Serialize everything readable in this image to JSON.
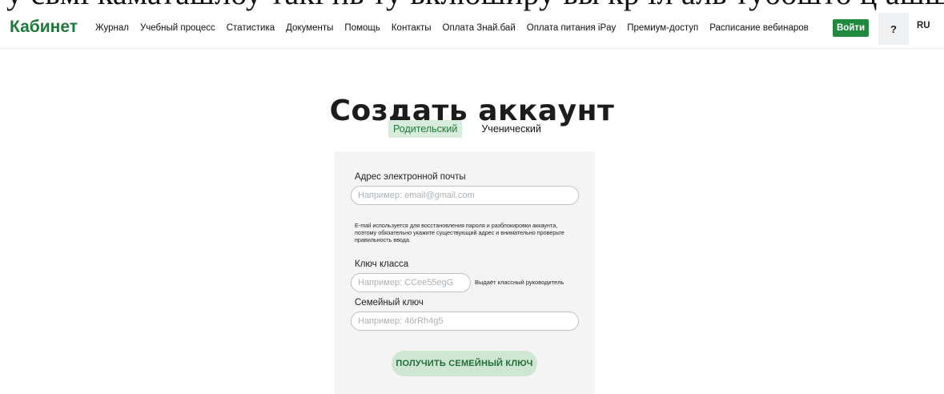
{
  "header": {
    "brand": "Кабинет",
    "nav_items": [
      "Журнал",
      "Учебный процесс",
      "Статистика",
      "Документы",
      "Помощь",
      "Контакты",
      "Оплата Знай.бай",
      "Оплата питания iPay",
      "Премиум-доступ",
      "Расписание вебинаров"
    ],
    "login_label": "Войти",
    "help_label": "?",
    "lang_label": "RU"
  },
  "page": {
    "title": "Создать аккаунт",
    "tabs": [
      {
        "label": "Родительский",
        "active": true
      },
      {
        "label": "Ученический",
        "active": false
      }
    ]
  },
  "form": {
    "email_label": "Адрес электронной почты",
    "email_placeholder": "Например: email@gmail.com",
    "email_note": "E-mail используется для восстановления пароля и разблокировки аккаунта, поэтому обязательно укажите существующий адрес и внимательно проверьте правильность ввода.",
    "class_key_label": "Ключ класса",
    "class_key_placeholder": "Например: CCee55egG",
    "class_key_note": "Выдаёт классный руководитель",
    "family_key_label": "Семейный ключ",
    "family_key_placeholder": "Например: 46rRh4g5",
    "get_family_key_button": "ПОЛУЧИТЬ СЕМЕЙНЫЙ КЛЮЧ"
  },
  "colors": {
    "brand_green": "#1f7a3a",
    "login_button": "#1f8a3e",
    "active_tab_bg": "#d7ecdc",
    "cta_bg": "#cfe6d3",
    "panel_bg": "#f4f4f4"
  }
}
